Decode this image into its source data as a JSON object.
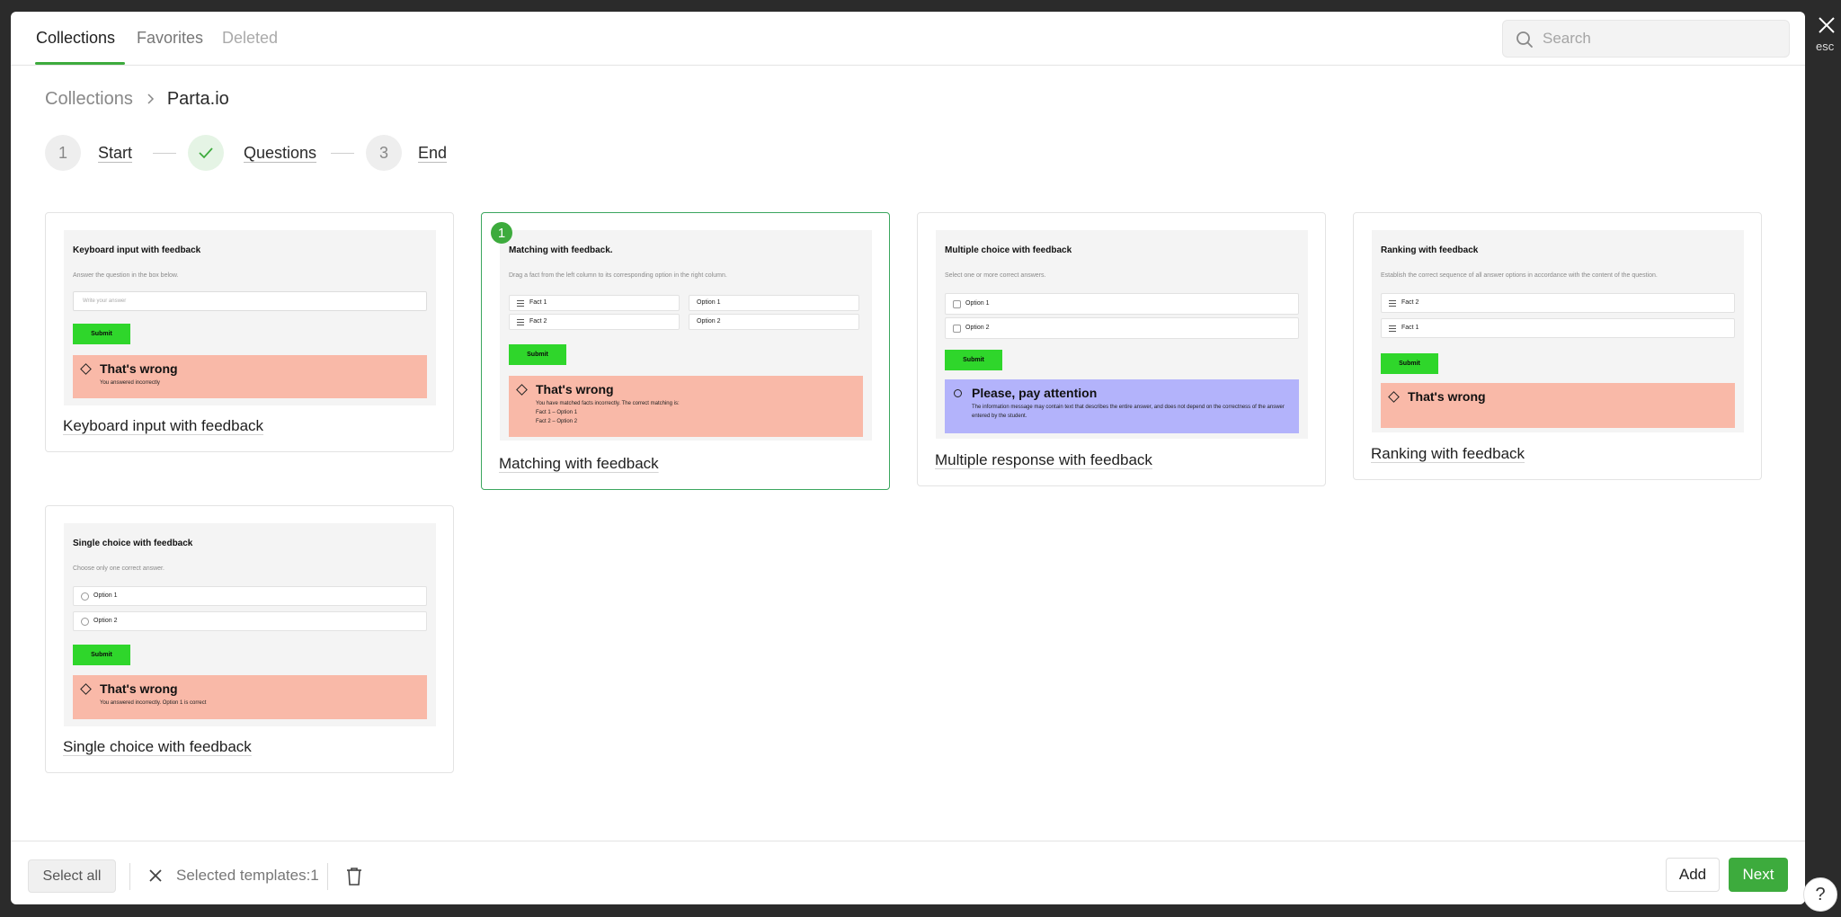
{
  "tabs": [
    {
      "label": "Collections",
      "active": true
    },
    {
      "label": "Favorites",
      "active": false
    },
    {
      "label": "Deleted",
      "active": false
    }
  ],
  "search": {
    "placeholder": "Search",
    "value": ""
  },
  "breadcrumb": {
    "parent": "Collections",
    "current": "Parta.io"
  },
  "steps": [
    {
      "number": "1",
      "label": "Start",
      "state": "default"
    },
    {
      "number": "",
      "label": "Questions",
      "state": "done",
      "icon": "check-icon"
    },
    {
      "number": "3",
      "label": "End",
      "state": "default"
    }
  ],
  "cards": [
    {
      "title": "Keyboard input with feedback",
      "selected": false,
      "preview": {
        "title": "Keyboard input with feedback",
        "subtitle": "Answer the question in the box below.",
        "input_placeholder": "Write your answer",
        "button": "Submit",
        "feedback_title": "That's wrong",
        "feedback_text": "You answered incorrectly"
      }
    },
    {
      "title": "Matching with feedback",
      "selected": true,
      "badge": "1",
      "preview": {
        "title": "Matching with feedback.",
        "subtitle": "Drag a fact from the left column to its corresponding option in the right column.",
        "facts": [
          "Fact 1",
          "Fact 2"
        ],
        "options": [
          "Option 1",
          "Option 2"
        ],
        "button": "Submit",
        "feedback_title": "That's wrong",
        "feedback_lines": [
          "You have matched facts incorrectly. The correct matching is:",
          "Fact 1 – Option 1",
          "Fact 2 – Option 2"
        ]
      }
    },
    {
      "title": "Multiple response with feedback",
      "selected": false,
      "preview": {
        "title": "Multiple choice with feedback",
        "subtitle": "Select one or more correct answers.",
        "options": [
          "Option 1",
          "Option 2"
        ],
        "button": "Submit",
        "feedback_title": "Please, pay attention",
        "feedback_text": "The information message may contain text that describes the entire answer, and does not depend on the correctness of the answer entered by the student."
      }
    },
    {
      "title": "Ranking with feedback",
      "selected": false,
      "preview": {
        "title": "Ranking with feedback",
        "subtitle": "Establish the correct sequence of all answer options in accordance with the content of the question.",
        "items": [
          "Fact 2",
          "Fact 1"
        ],
        "button": "Submit",
        "feedback_title": "That's wrong"
      }
    },
    {
      "title": "Single choice with feedback",
      "selected": false,
      "preview": {
        "title": "Single choice with feedback",
        "subtitle": "Choose only one correct answer.",
        "options": [
          "Option 1",
          "Option 2"
        ],
        "button": "Submit",
        "feedback_title": "That's wrong",
        "feedback_text": "You answered incorrectly. Option 1 is correct"
      }
    }
  ],
  "bottom": {
    "select_all": "Select all",
    "selected_text": "Selected templates:1",
    "add": "Add",
    "next": "Next"
  },
  "close_hint": "esc",
  "help": "?",
  "colors": {
    "accent": "#3dab3d",
    "submit_green": "#2fd62b",
    "wrong_bg": "#f9b9a8",
    "info_bg": "#b3b3fb"
  }
}
